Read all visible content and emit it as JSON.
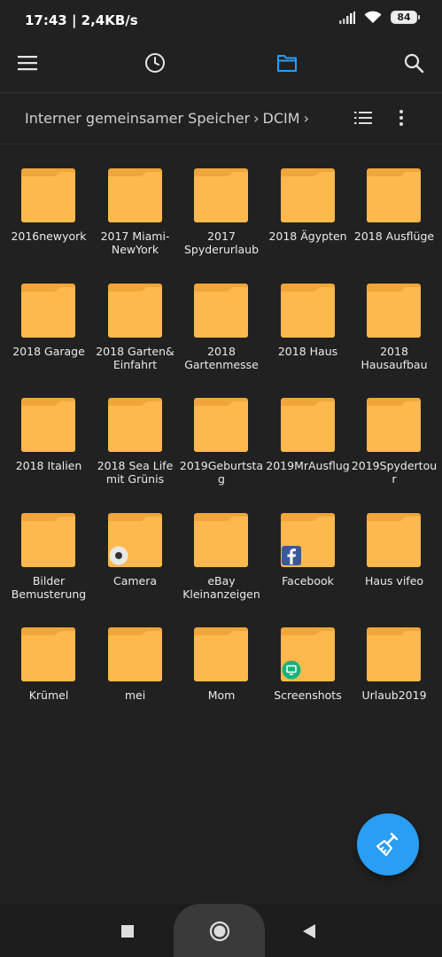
{
  "status_bar": {
    "time": "17:43 | 2,4KB/s",
    "battery": "84"
  },
  "toolbar": {
    "menu_icon": "menu-icon",
    "recent_icon": "clock-icon",
    "folder_icon": "folder-icon",
    "search_icon": "search-icon",
    "accent": "#2a9df4"
  },
  "breadcrumb": {
    "items": [
      "Interner gemeinsamer Speicher",
      "DCIM"
    ]
  },
  "folders": [
    {
      "name": "2016newyork"
    },
    {
      "name": "2017 Miami-NewYork"
    },
    {
      "name": "2017 Spyderurlaub"
    },
    {
      "name": "2018 Ägypten"
    },
    {
      "name": "2018 Ausflüge"
    },
    {
      "name": "2018 Garage"
    },
    {
      "name": "2018 Garten& Einfahrt"
    },
    {
      "name": "2018 Gartenmesse"
    },
    {
      "name": "2018 Haus"
    },
    {
      "name": "2018 Hausaufbau"
    },
    {
      "name": "2018 Italien"
    },
    {
      "name": "2018 Sea Life mit Grünis"
    },
    {
      "name": "2019Geburtstag"
    },
    {
      "name": "2019MrAusflug"
    },
    {
      "name": "2019Spydertour"
    },
    {
      "name": "Bilder Bemusterung"
    },
    {
      "name": "Camera",
      "badge": "camera-badge-icon"
    },
    {
      "name": "eBay Kleinanzeigen"
    },
    {
      "name": "Facebook",
      "badge": "facebook-badge-icon"
    },
    {
      "name": "Haus vifeo"
    },
    {
      "name": "Krümel"
    },
    {
      "name": "mei"
    },
    {
      "name": "Mom"
    },
    {
      "name": "Screenshots",
      "badge": "screenshot-badge-icon"
    },
    {
      "name": "Urlaub2019"
    }
  ],
  "colors": {
    "folder": "#fdb94d",
    "folder_tab": "#f0a63a",
    "background": "#212121"
  },
  "fab": {
    "icon": "broom-clean-icon"
  }
}
